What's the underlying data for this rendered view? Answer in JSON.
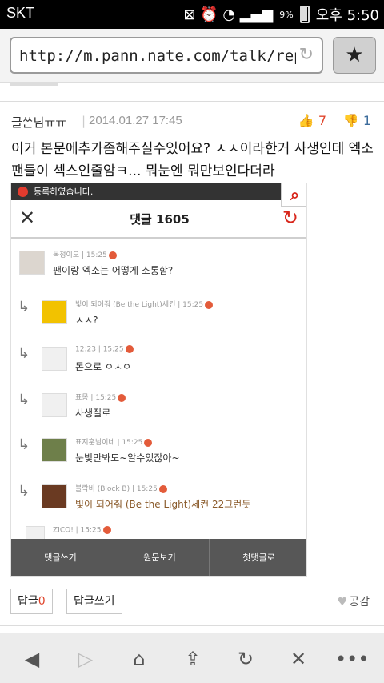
{
  "status": {
    "carrier": "SKT",
    "icons": "⊠ ⏰ ◔ ▂▄▆",
    "battery_pct": "9%",
    "time": "오후 5:50"
  },
  "url": {
    "text": "http://m.pann.nate.com/talk/reply/vie"
  },
  "reply": {
    "author": "글쓴님ㅠㅠ",
    "date": "2014.01.27 17:45",
    "likes": "7",
    "dislikes": "1",
    "body": "이거 본문에추가좀해주실수있어요? ㅅㅅ이라한거 사생인데 엑소팬들이 섹스인줄암ㅋ... 뭐눈엔 뭐만보인다더라"
  },
  "embedded": {
    "notice": "등록하였습니다.",
    "title": "댓글 1605",
    "comments": [
      {
        "meta": "목정이오 | 15:25",
        "text": "팬이랑 엑소는 어떻게 소통함?",
        "reply": false
      },
      {
        "meta": "빛이 되어줘 (Be the Light)세컨 | 15:25",
        "text": "ㅅㅅ?",
        "reply": true
      },
      {
        "meta": "12:23 | 15:25",
        "text": "돈으로 ㅇㅅㅇ",
        "reply": true
      },
      {
        "meta": "표몽 | 15:25",
        "text": "사생질로",
        "reply": true
      },
      {
        "meta": "표지훈님이네 | 15:25",
        "text": "눈빛만봐도~알수있잖아~",
        "reply": true
      },
      {
        "meta": "블락비 (Block B) | 15:25",
        "text": "빛이 되어줘 (Be the Light)세컨 22그런듯",
        "reply": true
      },
      {
        "meta": "ZICO! | 15:25",
        "text": "",
        "reply": false
      }
    ],
    "buttons": [
      "댓글쓰기",
      "원문보기",
      "첫댓글로"
    ]
  },
  "actions": {
    "reply_label": "답글",
    "reply_count": "0",
    "write_reply": "답글쓰기",
    "like": "공감"
  },
  "nav_icons": [
    "back-icon",
    "forward-icon",
    "home-icon",
    "share-icon",
    "refresh-icon",
    "close-icon",
    "more-icon"
  ]
}
